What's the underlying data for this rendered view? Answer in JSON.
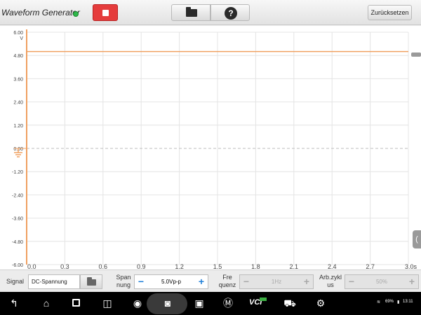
{
  "app": {
    "title": "Waveform Generator",
    "status_color": "#2fb84a"
  },
  "toolbar": {
    "stop_icon": "stop-icon",
    "folder_icon": "folder-icon",
    "help_label": "?",
    "reset_label": "Zurücksetzen"
  },
  "chart_data": {
    "type": "line",
    "y_unit": "V",
    "x_unit": "s",
    "ylim": [
      -6.0,
      6.0
    ],
    "xlim": [
      0.0,
      3.0
    ],
    "y_ticks": [
      "6.00",
      "4.80",
      "3.60",
      "2.40",
      "1.20",
      "0.00",
      "-1.20",
      "-2.40",
      "-3.60",
      "-4.80",
      "-6.00"
    ],
    "x_ticks": [
      "0.0",
      "0.3",
      "0.6",
      "0.9",
      "1.2",
      "1.5",
      "1.8",
      "2.1",
      "2.4",
      "2.7",
      "3.0s"
    ],
    "grid": true,
    "series": [
      {
        "color": "#f0a060",
        "x": [
          0.0,
          3.0
        ],
        "y": [
          5.0,
          5.0
        ]
      }
    ]
  },
  "controls": {
    "signal_label": "Signal",
    "signal_value": "DC-Spannung",
    "amplitude_label_1": "Span",
    "amplitude_label_2": "nung",
    "amplitude_value": "5.0Vp-p",
    "frequency_label_1": "Fre",
    "frequency_label_2": "quenz",
    "frequency_value": "1Hz",
    "duty_label_1": "Arb.zykl",
    "duty_label_2": "us",
    "duty_value": "50%",
    "minus": "−",
    "plus": "+",
    "accent": "#1f7fd8"
  },
  "navbar": {
    "vci_label": "VCI",
    "battery": "69%",
    "time": "13:11"
  }
}
